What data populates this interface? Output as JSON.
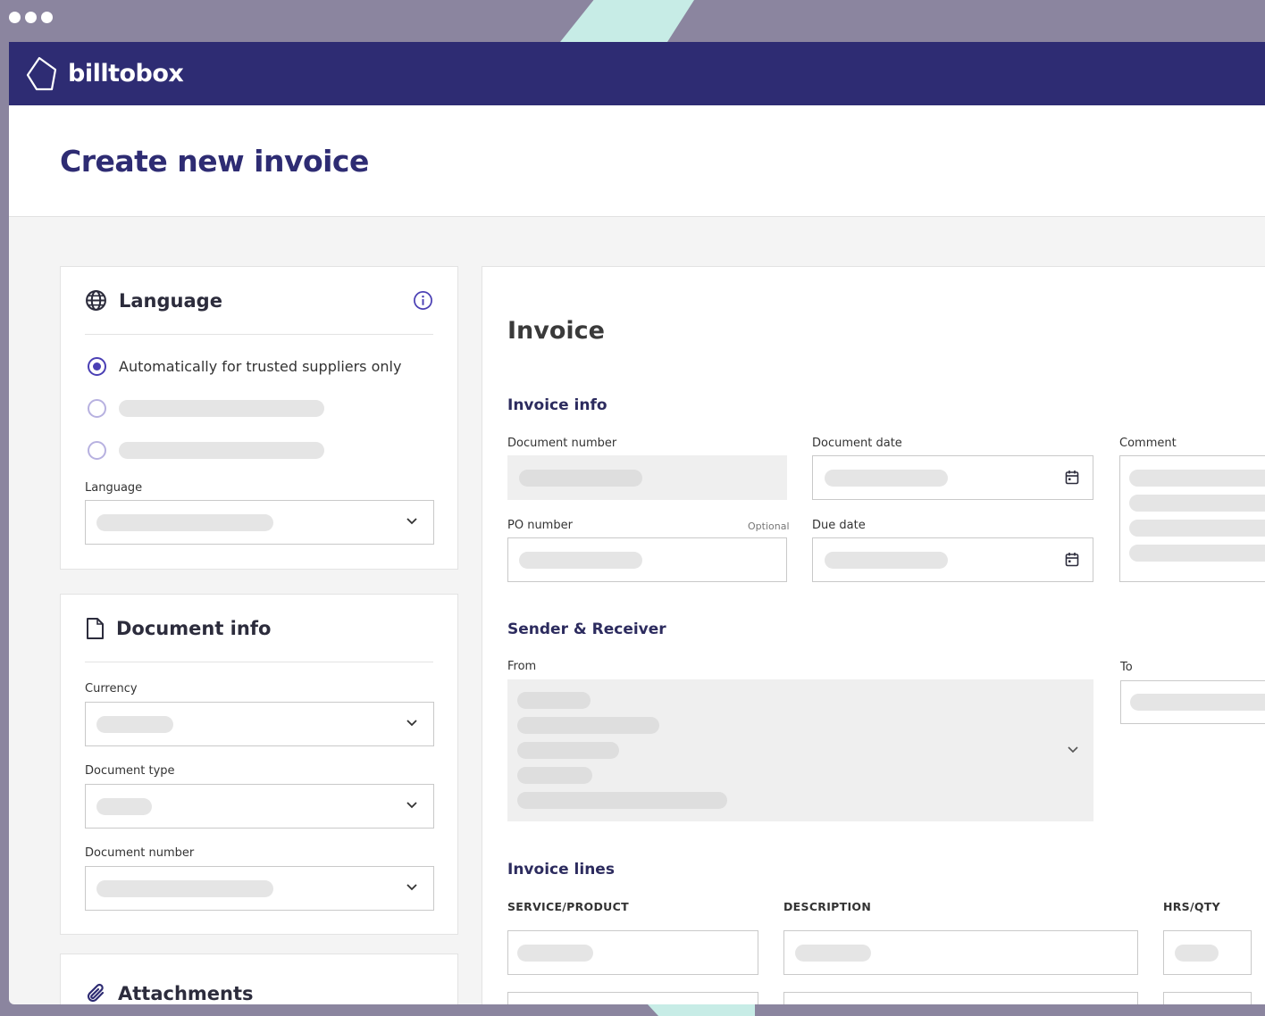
{
  "app": {
    "brand": "billtobox"
  },
  "page": {
    "title": "Create new invoice"
  },
  "language_card": {
    "title": "Language",
    "option_selected": "Automatically for trusted suppliers only",
    "language_label": "Language"
  },
  "document_info_card": {
    "title": "Document info",
    "currency_label": "Currency",
    "document_type_label": "Document type",
    "document_number_label": "Document number"
  },
  "attachments_card": {
    "title": "Attachments"
  },
  "invoice": {
    "title": "Invoice",
    "info_title": "Invoice info",
    "document_number_label": "Document number",
    "document_date_label": "Document date",
    "comment_label": "Comment",
    "po_number_label": "PO number",
    "optional_label": "Optional",
    "due_date_label": "Due date",
    "sender_receiver_title": "Sender & Receiver",
    "from_label": "From",
    "to_label": "To",
    "lines_title": "Invoice lines",
    "col_service": "SERVICE/PRODUCT",
    "col_description": "DESCRIPTION",
    "col_qty": "HRS/QTY"
  },
  "colors": {
    "brand_navy": "#2e2c73",
    "accent_purple": "#4a3fb4",
    "frame": "#8b859f",
    "stripe_mint": "#c7ece6"
  },
  "icons": [
    "window-dots",
    "logo-mark-icon",
    "globe-icon",
    "info-icon",
    "document-icon",
    "paperclip-icon",
    "chevron-down-icon",
    "calendar-icon"
  ]
}
